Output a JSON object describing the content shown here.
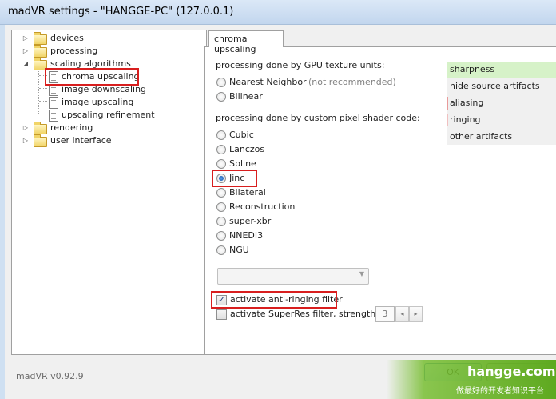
{
  "window": {
    "title": "madVR settings - \"HANGGE-PC\" (127.0.0.1)"
  },
  "tree": {
    "devices": "devices",
    "processing": "processing",
    "scaling_algorithms": "scaling algorithms",
    "chroma_upscaling": "chroma upscaling",
    "image_downscaling": "image downscaling",
    "image_upscaling": "image upscaling",
    "upscaling_refinement": "upscaling refinement",
    "rendering": "rendering",
    "user_interface": "user interface"
  },
  "version": "madVR v0.92.9",
  "tab": {
    "label": "chroma upscaling"
  },
  "gpu_section": {
    "heading": "processing done by GPU texture units:",
    "nearest": "Nearest Neighbor",
    "nearest_hint": "(not recommended)",
    "bilinear": "Bilinear"
  },
  "shader_section": {
    "heading": "processing done by custom pixel shader code:",
    "cubic": "Cubic",
    "lanczos": "Lanczos",
    "spline": "Spline",
    "jinc": "Jinc",
    "bilateral": "Bilateral",
    "reconstruction": "Reconstruction",
    "superxbr": "super-xbr",
    "nnedi3": "NNEDI3",
    "ngu": "NGU"
  },
  "selected_algorithm": "Jinc",
  "options": {
    "anti_ringing": "activate anti-ringing filter",
    "anti_ringing_checked": true,
    "superres": "activate SuperRes filter, strength:",
    "superres_checked": false,
    "strength": "3"
  },
  "artifacts": {
    "sharpness": "sharpness",
    "hide_source": "hide source artifacts",
    "aliasing": "aliasing",
    "ringing": "ringing",
    "other": "other artifacts"
  },
  "buttons": {
    "ok": "OK"
  },
  "watermark": {
    "site": "hangge.com",
    "tagline": "做最好的开发者知识平台"
  },
  "colors": {
    "highlight_red": "#d81e1e",
    "sharpness_green": "#d6f2c8",
    "watermark_green": "#5ea91f"
  }
}
